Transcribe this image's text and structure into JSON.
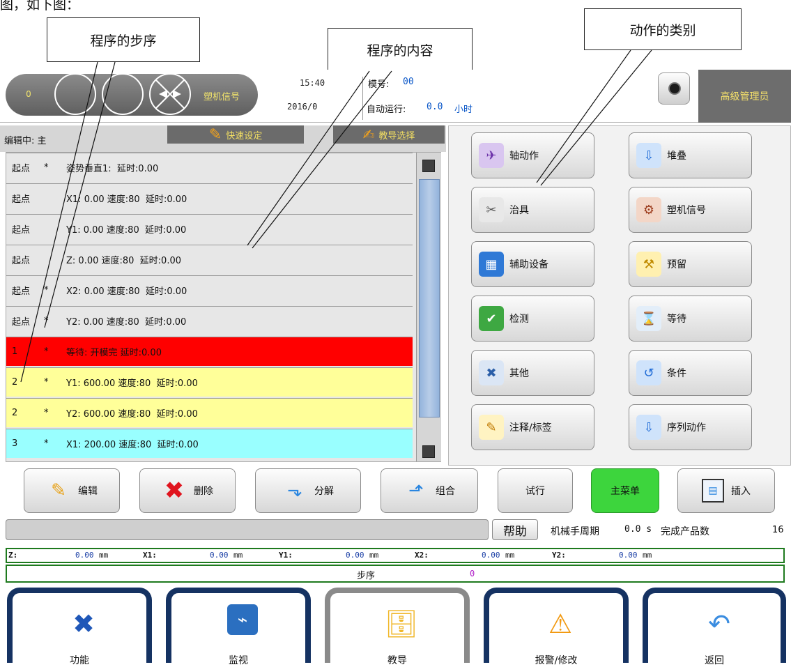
{
  "top_doc": {
    "text": "图，如下图："
  },
  "callouts": [
    {
      "text": "程序的步序"
    },
    {
      "text": "程序的内容"
    },
    {
      "text": "动作的类别"
    }
  ],
  "header": {
    "counter": "0",
    "signal_label": "塑机信号",
    "time": "15:40",
    "date": "2016/0",
    "mold_key": "模号:",
    "mold_value": "00",
    "auto_key": "自动运行:",
    "auto_value": "0.0",
    "auto_unit": "小时",
    "admin_label": "高级管理员"
  },
  "editor": {
    "editing_label": "编辑中: 主",
    "quick_setup": "快速设定",
    "teach_select": "教导选择"
  },
  "program_rows": [
    {
      "step": "起点",
      "star": "*",
      "content": "姿势垂直1:  延时:0.00",
      "color": "#e7e7e7"
    },
    {
      "step": "起点",
      "star": "",
      "content": "X1: 0.00 速度:80  延时:0.00",
      "color": "#e7e7e7"
    },
    {
      "step": "起点",
      "star": "",
      "content": "Y1: 0.00 速度:80  延时:0.00",
      "color": "#e7e7e7"
    },
    {
      "step": "起点",
      "star": "",
      "content": "Z: 0.00 速度:80  延时:0.00",
      "color": "#e7e7e7"
    },
    {
      "step": "起点",
      "star": "*",
      "content": "X2: 0.00 速度:80  延时:0.00",
      "color": "#e7e7e7"
    },
    {
      "step": "起点",
      "star": "*",
      "content": "Y2: 0.00 速度:80  延时:0.00",
      "color": "#e7e7e7"
    },
    {
      "step": "1",
      "star": "*",
      "content": "等待: 开模完 延时:0.00",
      "color": "#ff0000"
    },
    {
      "step": "2",
      "star": "*",
      "content": "Y1: 600.00 速度:80  延时:0.00",
      "color": "#ffff99"
    },
    {
      "step": "2",
      "star": "*",
      "content": "Y2: 600.00 速度:80  延时:0.00",
      "color": "#ffff99"
    },
    {
      "step": "3",
      "star": "*",
      "content": "X1: 200.00 速度:80  延时:0.00",
      "color": "#99ffff"
    }
  ],
  "actions": [
    {
      "label": "轴动作",
      "icon": "axis-icon",
      "glyph": "✈",
      "bg": "#d9c6f0",
      "fg": "#6a2fa8"
    },
    {
      "label": "堆叠",
      "icon": "stack-icon",
      "glyph": "⇩",
      "bg": "#cfe3fb",
      "fg": "#1d6ad6"
    },
    {
      "label": "治具",
      "icon": "fixture-icon",
      "glyph": "✂",
      "bg": "#e8e8e8",
      "fg": "#555555"
    },
    {
      "label": "塑机信号",
      "icon": "machine-icon",
      "glyph": "⚙",
      "bg": "#f3d6c7",
      "fg": "#9b3a1b"
    },
    {
      "label": "辅助设备",
      "icon": "aux-device-icon",
      "glyph": "▦",
      "bg": "#2f79d6",
      "fg": "#ffffff"
    },
    {
      "label": "预留",
      "icon": "robot-arm-icon",
      "glyph": "⚒",
      "bg": "#fff0b0",
      "fg": "#c08a00"
    },
    {
      "label": "检测",
      "icon": "shield-check-icon",
      "glyph": "✔",
      "bg": "#3ea842",
      "fg": "#ffffff"
    },
    {
      "label": "等待",
      "icon": "hourglass-icon",
      "glyph": "⌛",
      "bg": "#e3eef9",
      "fg": "#5a7fa8"
    },
    {
      "label": "其他",
      "icon": "tools-icon",
      "glyph": "✖",
      "bg": "#dbe6f5",
      "fg": "#2a5ea8"
    },
    {
      "label": "条件",
      "icon": "loop-arrow-icon",
      "glyph": "↺",
      "bg": "#cfe3fb",
      "fg": "#1d6ad6"
    },
    {
      "label": "注释/标签",
      "icon": "pencil-icon",
      "glyph": "✎",
      "bg": "#fff3c2",
      "fg": "#c07a00"
    },
    {
      "label": "序列动作",
      "icon": "sequence-icon",
      "glyph": "⇩",
      "bg": "#cfe3fb",
      "fg": "#1d6ad6"
    }
  ],
  "bottom_buttons": {
    "edit": "编辑",
    "delete": "删除",
    "split": "分解",
    "combine": "组合",
    "trial": "试行",
    "main_menu": "主菜单",
    "insert": "插入"
  },
  "status": {
    "help": "帮助",
    "cycle_label": "机械手周期",
    "cycle_value": "0.0 s",
    "finished_label": "完成产品数",
    "finished_value": "16"
  },
  "coords": [
    {
      "key": "Z:",
      "value": "0.00",
      "unit": "mm"
    },
    {
      "key": "X1:",
      "value": "0.00",
      "unit": "mm"
    },
    {
      "key": "Y1:",
      "value": "0.00",
      "unit": "mm"
    },
    {
      "key": "X2:",
      "value": "0.00",
      "unit": "mm"
    },
    {
      "key": "Y2:",
      "value": "0.00",
      "unit": "mm"
    }
  ],
  "step": {
    "label": "步序",
    "value": "0"
  },
  "nav": {
    "function": "功能",
    "monitor": "监视",
    "teach": "教导",
    "alarm": "报警/修改",
    "back": "返回"
  },
  "colors": {
    "header_pill": "#6f6f6f",
    "accent_yellow": "#f3df62",
    "main_menu_green": "#3dd53d",
    "nav_border": "#153262",
    "coord_border": "#1e7a1e"
  }
}
